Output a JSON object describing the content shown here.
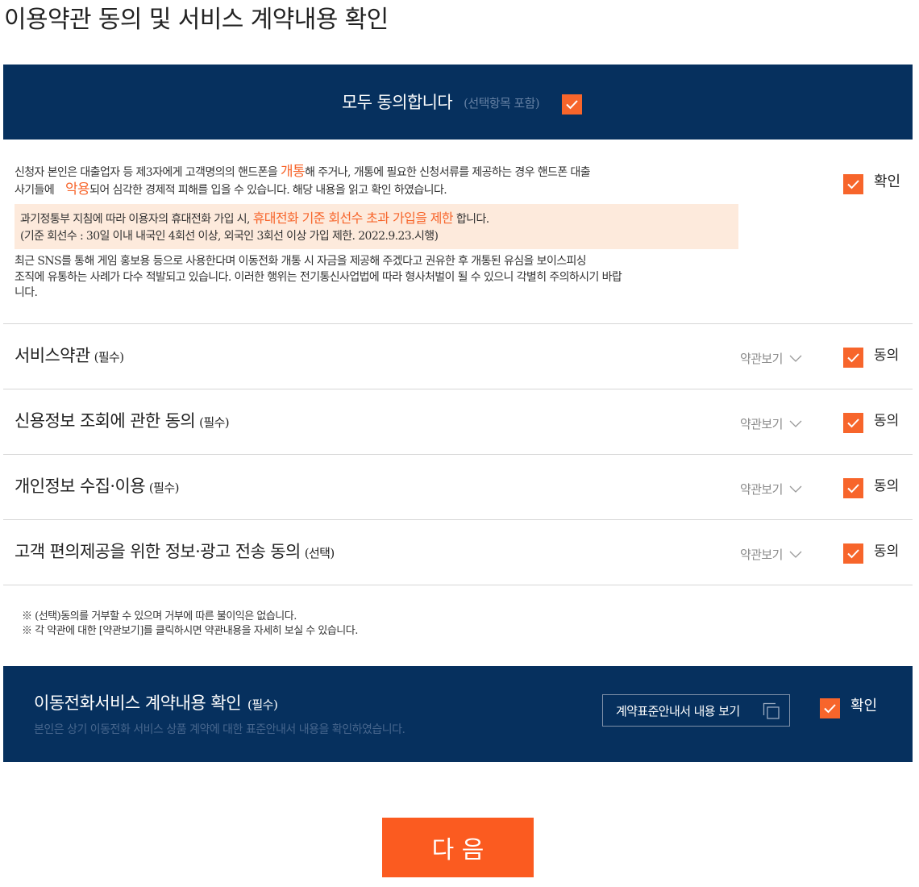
{
  "page": {
    "title": "이용약관 동의 및 서비스 계약내용 확인"
  },
  "colors": {
    "navy": "#06305e",
    "orange": "#f7652b",
    "highlight_bg": "#fdeadc",
    "next_button": "#fb5b20"
  },
  "icons": {
    "checkbox_mark": "check-icon",
    "view_toggle": "chevron-down-icon",
    "contract_view": "new-window-icon"
  },
  "agree_all": {
    "label": "모두 동의합니다",
    "note": "(선택항목 포함)",
    "checked": true
  },
  "notice": {
    "line1": {
      "pre": "신청자 본인은 대출업자 등 제3자에게 고객명의의 핸드폰을 ",
      "highlight": "개통",
      "post": "해 주거나, 개통에 필요한 신청서류를 제공하는 경우 핸드폰 대출"
    },
    "line2": {
      "pre": "사기들에 ",
      "highlight": "악용",
      "post": "되어 심각한 경제적 피해를 입을 수 있습니다. 해당 내용을 읽고 확인 하였습니다."
    },
    "check_label": "확인",
    "checked": true
  },
  "limit_notice": {
    "line1": {
      "pre": "과기정통부 지침에 따라 이용자의 휴대전화 가입 시, ",
      "highlight": "휴대전화 기준 회선수 초과 가입을 제한",
      "post": " 합니다."
    },
    "line2": "(기준 회선수 : 30일 이내 내국인 4회선 이상, 외국인 3회선 이상 가입 제한. 2022.9.23.시행)"
  },
  "warning_lines": [
    "최근 SNS를 통해 게임 홍보용 등으로 사용한다며 이동전화 개통 시 자금을 제공해 주겠다고 권유한 후 개통된 유심을 보이스피싱",
    "조직에 유통하는 사례가 다수 적발되고 있습니다. 이러한 행위는 전기통신사업법에 따라 형사처벌이 될 수 있으니 각별히 주의하시기 바랍",
    "니다."
  ],
  "rows": [
    {
      "title": "서비스약관",
      "tag": "(필수)",
      "view_label": "약관보기",
      "check_label": "동의",
      "checked": true
    },
    {
      "title": "신용정보 조회에 관한 동의",
      "tag": "(필수)",
      "view_label": "약관보기",
      "check_label": "동의",
      "checked": true
    },
    {
      "title": "개인정보 수집·이용",
      "tag": "(필수)",
      "view_label": "약관보기",
      "check_label": "동의",
      "checked": true
    },
    {
      "title": "고객 편의제공을 위한 정보·광고 전송 동의",
      "tag": "(선택)",
      "view_label": "약관보기",
      "check_label": "동의",
      "checked": true
    }
  ],
  "footnotes": [
    "※ (선택)동의를 거부할 수 있으며 거부에 따른 불이익은 없습니다.",
    "※ 각 약관에 대한 [약관보기]를 클릭하시면 약관내용을 자세히 보실 수 있습니다."
  ],
  "contract": {
    "title": "이동전화서비스 계약내용 확인",
    "tag": "(필수)",
    "desc": "본인은 상기 이동전화 서비스 상품 계약에 대한 표준안내서 내용을 확인하였습니다.",
    "view_button": "계약표준안내서 내용 보기",
    "check_label": "확인",
    "checked": true
  },
  "next_button": {
    "label": "다 음"
  }
}
